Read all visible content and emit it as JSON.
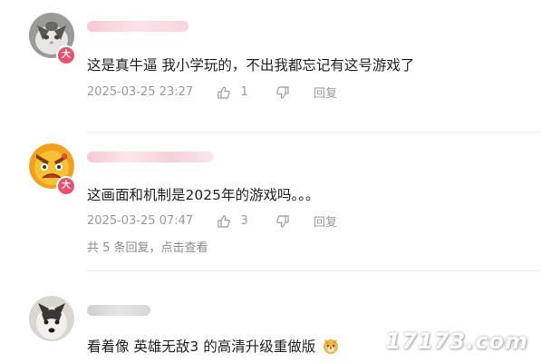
{
  "comments": [
    {
      "text": "这是真牛逼 我小学玩的，不出我都忘记有这号游戏了",
      "timestamp": "2025-03-25 23:27",
      "likes": "1",
      "reply_label": "回复",
      "badge": "大",
      "avatar_icon": "cat-avatar"
    },
    {
      "text": "这画面和机制是2025年的游戏吗。。。",
      "timestamp": "2025-03-25 07:47",
      "likes": "3",
      "reply_label": "回复",
      "badge": "大",
      "avatar_icon": "angry-emoji-avatar",
      "replies_summary": "共 5 条回复，点击查看"
    },
    {
      "text": "看着像 英雄无敌3 的高清升级重做版",
      "avatar_icon": "husky-dog-avatar",
      "emoji_icon": "doge-emoji"
    }
  ],
  "watermark": "17173.com",
  "colors": {
    "badge": "#f04e6e",
    "meta_text": "#9a9a9a",
    "username_blur": "#f7c9d6"
  }
}
